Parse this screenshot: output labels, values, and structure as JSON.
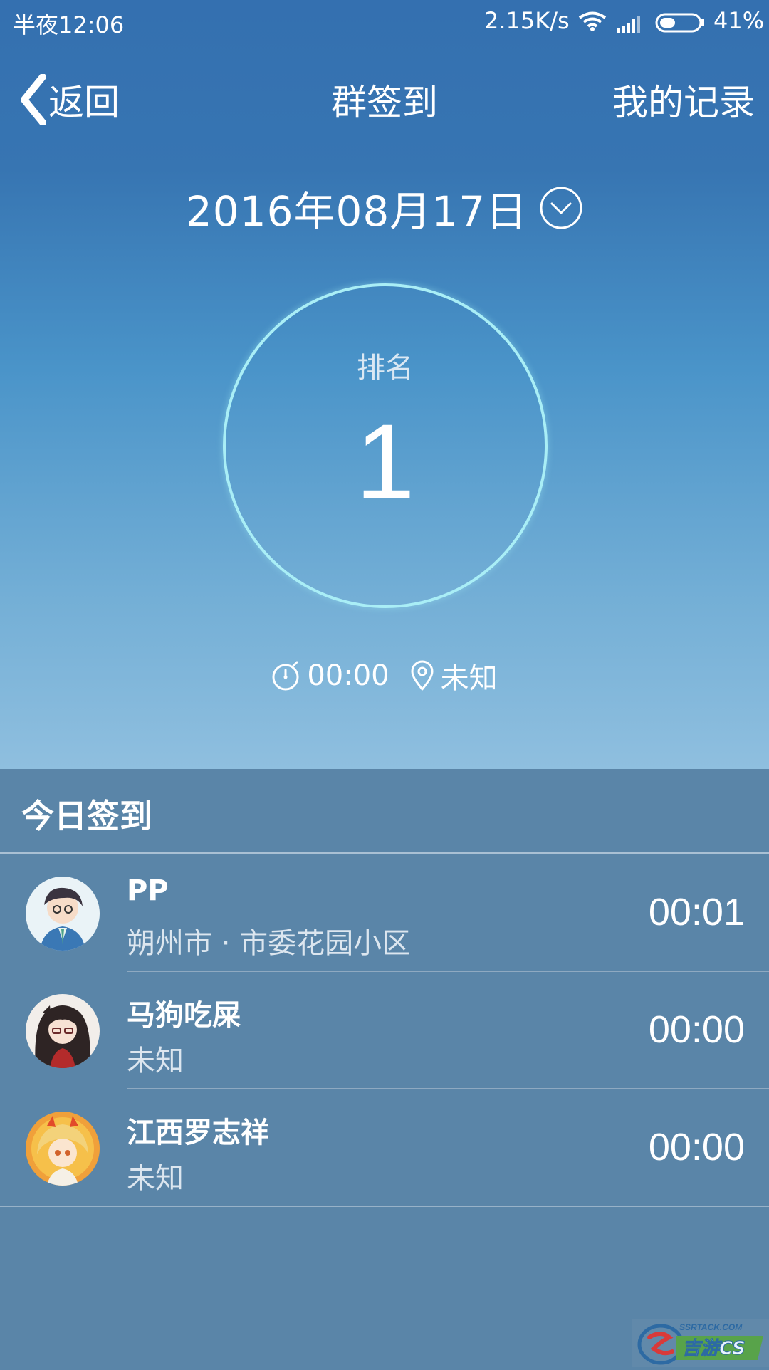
{
  "status_bar": {
    "time": "半夜12:06",
    "network_speed": "2.15K/s",
    "battery_percent": "41%",
    "battery_level": 0.41,
    "icons": [
      "wifi-icon",
      "signal-icon",
      "battery-icon"
    ]
  },
  "nav": {
    "back_label": "返回",
    "title": "群签到",
    "records_label": "我的记录"
  },
  "date": {
    "text": "2016年08月17日",
    "icon": "chevron-down-circle-icon"
  },
  "rank": {
    "label": "排名",
    "value": "1"
  },
  "meta": {
    "time": "00:00",
    "location": "未知",
    "icons": [
      "stopwatch-icon",
      "location-pin-icon"
    ]
  },
  "list": {
    "header": "今日签到",
    "items": [
      {
        "name": "PP",
        "location": "朔州市 · 市委花园小区",
        "time": "00:01",
        "avatar": "avatar-icon"
      },
      {
        "name": "马狗吃屎",
        "location": "未知",
        "time": "00:00",
        "avatar": "avatar-icon"
      },
      {
        "name": "江西罗志祥",
        "location": "未知",
        "time": "00:00",
        "avatar": "avatar-icon"
      }
    ]
  },
  "watermark": {
    "domain": "SSRTACK.COM",
    "text": "吉游CS"
  },
  "colors": {
    "header_gradient_top": "#3470b0",
    "header_gradient_bottom": "#8fbfdf",
    "list_background": "#5a85a8",
    "ring": "#a9eef6",
    "text": "#ffffff"
  }
}
